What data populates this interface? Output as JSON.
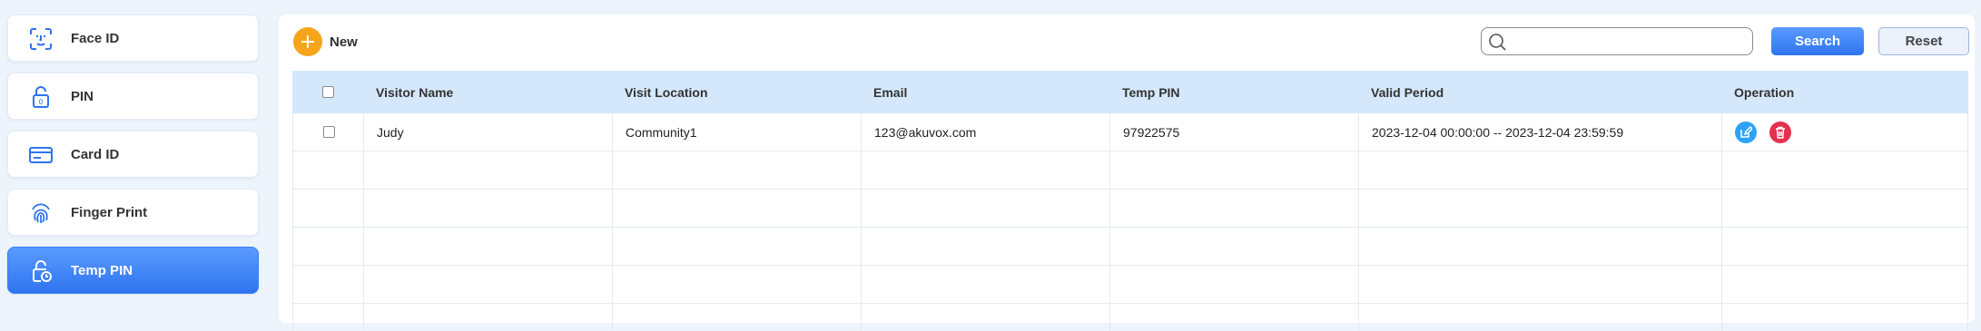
{
  "sidebar": {
    "items": [
      {
        "label": "Face ID",
        "icon": "face-id-icon"
      },
      {
        "label": "PIN",
        "icon": "lock-icon"
      },
      {
        "label": "Card ID",
        "icon": "card-icon"
      },
      {
        "label": "Finger Print",
        "icon": "fingerprint-icon"
      },
      {
        "label": "Temp PIN",
        "icon": "temp-pin-icon",
        "active": true
      }
    ]
  },
  "toolbar": {
    "new_label": "New",
    "search_placeholder": "",
    "search_value": "",
    "search_label": "Search",
    "reset_label": "Reset"
  },
  "table": {
    "columns": [
      "Visitor Name",
      "Visit Location",
      "Email",
      "Temp PIN",
      "Valid Period",
      "Operation"
    ],
    "rows": [
      {
        "visitor_name": "Judy",
        "visit_location": "Community1",
        "email": "123@akuvox.com",
        "temp_pin": "97922575",
        "valid_period": "2023-12-04 00:00:00 -- 2023-12-04 23:59:59"
      }
    ]
  },
  "colors": {
    "accent": "#2f74f0",
    "new_button": "#f6a51a",
    "edit": "#2ca3f5",
    "delete": "#e5304e",
    "header_bg": "#d5e8fb"
  }
}
